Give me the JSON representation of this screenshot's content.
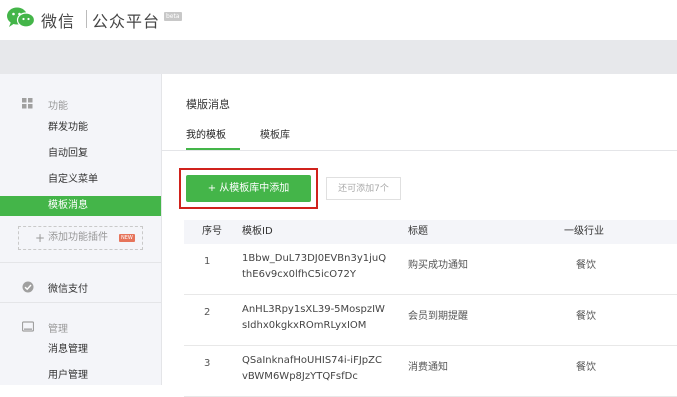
{
  "brand": {
    "name": "微信",
    "platform": "公众平台",
    "beta": "beta"
  },
  "sidebar": {
    "group_function": "功能",
    "items": [
      {
        "label": "群发功能"
      },
      {
        "label": "自动回复"
      },
      {
        "label": "自定义菜单"
      },
      {
        "label": "模板消息"
      }
    ],
    "add_plugin": "添加功能插件",
    "new_badge": "NEW",
    "group_pay": "微信支付",
    "group_manage": "管理",
    "manage_items": [
      {
        "label": "消息管理"
      },
      {
        "label": "用户管理"
      }
    ],
    "accent_color": "#44b549"
  },
  "main": {
    "title": "模版消息",
    "tabs": [
      {
        "label": "我的模板"
      },
      {
        "label": "模板库"
      }
    ],
    "add_button": "+ 从模板库中添加",
    "remaining": "还可添加7个",
    "highlight_color": "#d0221c",
    "table": {
      "headers": {
        "seq": "序号",
        "id": "模板ID",
        "title": "标题",
        "industry": "一级行业"
      },
      "rows": [
        {
          "seq": "1",
          "id_line1": "1Bbw_DuL73DJ0EVBn3y1juQ",
          "id_line2": "thE6v9cx0lfhC5icO72Y",
          "title": "购买成功通知",
          "industry": "餐饮"
        },
        {
          "seq": "2",
          "id_line1": "AnHL3Rpy1sXL39-5MospzIW",
          "id_line2": "sIdhx0kgkxROmRLyxIOM",
          "title": "会员到期提醒",
          "industry": "餐饮"
        },
        {
          "seq": "3",
          "id_line1": "QSaInknafHoUHIS74i-iFJpZC",
          "id_line2": "vBWM6Wp8JzYTQFsfDc",
          "title": "消费通知",
          "industry": "餐饮"
        }
      ]
    }
  }
}
